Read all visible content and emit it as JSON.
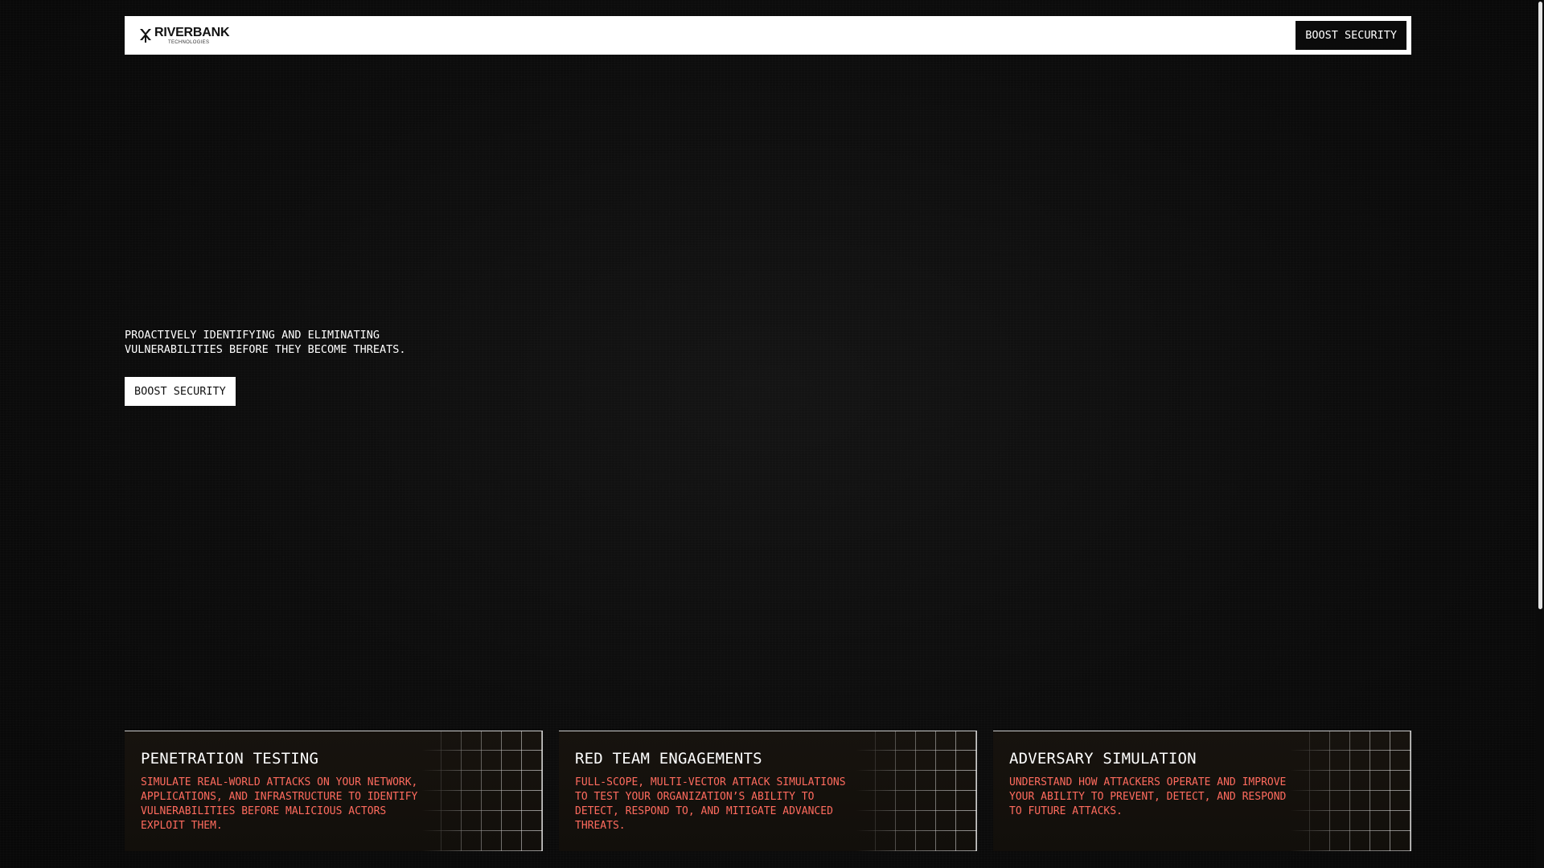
{
  "header": {
    "logo": {
      "icon": "riverbank-logo-icon",
      "name": "RIVERBANK",
      "subtitle": "TECHNOLOGIES"
    },
    "cta_label": "BOOST SECURITY"
  },
  "hero": {
    "tagline": "PROACTIVELY IDENTIFYING AND ELIMINATING\nVULNERABILITIES BEFORE THEY BECOME THREATS.",
    "cta_label": "BOOST SECURITY"
  },
  "services": [
    {
      "title": "PENETRATION TESTING",
      "description": "SIMULATE REAL-WORLD ATTACKS ON YOUR NETWORK, APPLICATIONS, AND INFRASTRUCTURE TO IDENTIFY VULNERABILITIES BEFORE MALICIOUS ACTORS EXPLOIT THEM."
    },
    {
      "title": "RED TEAM ENGAGEMENTS",
      "description": "FULL-SCOPE, MULTI-VECTOR ATTACK SIMULATIONS TO TEST YOUR ORGANIZATION’S ABILITY TO DETECT, RESPOND TO, AND MITIGATE ADVANCED THREATS."
    },
    {
      "title": "ADVERSARY SIMULATION",
      "description": "UNDERSTAND HOW ATTACKERS OPERATE AND IMPROVE YOUR ABILITY TO PREVENT, DETECT, AND RESPOND TO FUTURE ATTACKS."
    }
  ],
  "colors": {
    "background": "#0b0b0b",
    "accent_text": "#ff6b5e",
    "header_bg": "#ffffff"
  }
}
